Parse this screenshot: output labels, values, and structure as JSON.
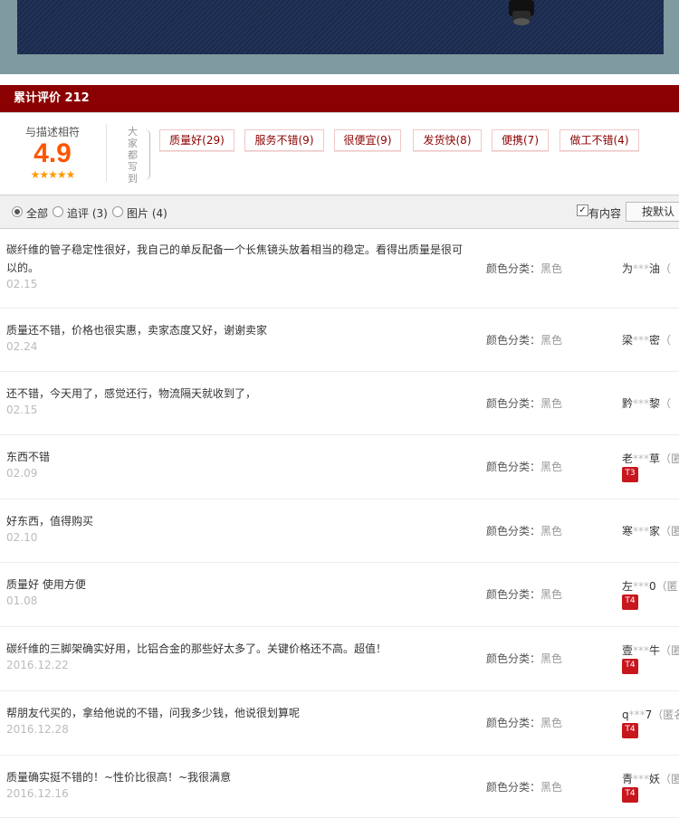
{
  "header": {
    "title": "累计评价 212"
  },
  "summary": {
    "score_label": "与描述相符",
    "score": "4.9",
    "stars": "★★★★★",
    "tags_prefix": "大家都写到",
    "tags": [
      {
        "label": "质量好(29)"
      },
      {
        "label": "服务不错(9)"
      },
      {
        "label": "很便宜(9)"
      },
      {
        "label": "发货快(8)"
      },
      {
        "label": "便携(7)"
      },
      {
        "label": "做工不错(4)"
      }
    ]
  },
  "filter": {
    "all": "全部",
    "followup": "追评 (3)",
    "pictures": "图片 (4)",
    "has_content": "有内容",
    "sort_button": "按默认"
  },
  "reviews": [
    {
      "text": "碳纤维的管子稳定性很好，我自己的单反配备一个长焦镜头放着相当的稳定。看得出质量是很可以的。",
      "date": "02.15",
      "sku_label": "颜色分类：",
      "sku_value": "黑色",
      "user_a": "为",
      "user_mask": "***",
      "user_b": "油",
      "paren": "（",
      "level": ""
    },
    {
      "text": "质量还不错，价格也很实惠，卖家态度又好，谢谢卖家",
      "date": "02.24",
      "sku_label": "颜色分类：",
      "sku_value": "黑色",
      "user_a": "梁",
      "user_mask": "***",
      "user_b": "密",
      "paren": "（",
      "level": ""
    },
    {
      "text": "还不错，今天用了，感觉还行，物流隔天就收到了，",
      "date": "02.15",
      "sku_label": "颜色分类：",
      "sku_value": "黑色",
      "user_a": "黔",
      "user_mask": "***",
      "user_b": "黎",
      "paren": "（",
      "level": ""
    },
    {
      "text": "东西不错",
      "date": "02.09",
      "sku_label": "颜色分类：",
      "sku_value": "黑色",
      "user_a": "老",
      "user_mask": "***",
      "user_b": "草",
      "paren": "（匿",
      "level": "T3"
    },
    {
      "text": "好东西，值得购买",
      "date": "02.10",
      "sku_label": "颜色分类：",
      "sku_value": "黑色",
      "user_a": "寒",
      "user_mask": "***",
      "user_b": "家",
      "paren": "（匿",
      "level": ""
    },
    {
      "text": "质量好 使用方便",
      "date": "01.08",
      "sku_label": "颜色分类：",
      "sku_value": "黑色",
      "user_a": "左",
      "user_mask": "***",
      "user_b": "0",
      "paren": "（匿",
      "level": "T4"
    },
    {
      "text": "碳纤维的三脚架确实好用，比铝合金的那些好太多了。关键价格还不高。超值！",
      "date": "2016.12.22",
      "sku_label": "颜色分类：",
      "sku_value": "黑色",
      "user_a": "壹",
      "user_mask": "***",
      "user_b": "牛",
      "paren": "（匿",
      "level": "T4"
    },
    {
      "text": "帮朋友代买的，拿给他说的不错，问我多少钱，他说很划算呢",
      "date": "2016.12.28",
      "sku_label": "颜色分类：",
      "sku_value": "黑色",
      "user_a": "q",
      "user_mask": "***",
      "user_b": "7",
      "paren": "（匿名",
      "level": "T4"
    },
    {
      "text": "质量确实挺不错的！~性价比很高！~我很满意",
      "date": "2016.12.16",
      "sku_label": "颜色分类：",
      "sku_value": "黑色",
      "user_a": "青",
      "user_mask": "***",
      "user_b": "妖",
      "paren": "（匿",
      "level": "T4"
    }
  ]
}
